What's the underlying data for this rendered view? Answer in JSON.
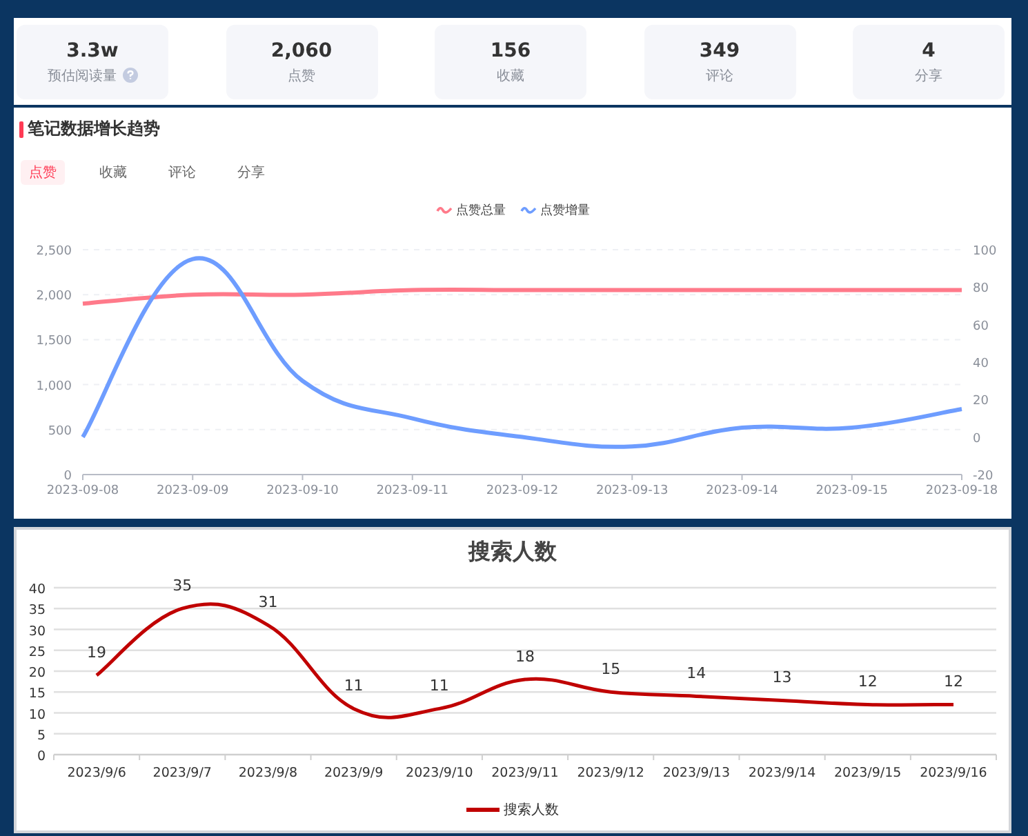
{
  "stats": [
    {
      "value": "3.3w",
      "label": "预估阅读量",
      "help": true
    },
    {
      "value": "2,060",
      "label": "点赞",
      "help": false
    },
    {
      "value": "156",
      "label": "收藏",
      "help": false
    },
    {
      "value": "349",
      "label": "评论",
      "help": false
    },
    {
      "value": "4",
      "label": "分享",
      "help": false
    }
  ],
  "trend": {
    "title": "笔记数据增长趋势",
    "tabs": [
      {
        "label": "点赞",
        "selected": true
      },
      {
        "label": "收藏",
        "selected": false
      },
      {
        "label": "评论",
        "selected": false
      },
      {
        "label": "分享",
        "selected": false
      }
    ],
    "chart_data": {
      "type": "line",
      "categories": [
        "2023-09-08",
        "2023-09-09",
        "2023-09-10",
        "2023-09-11",
        "2023-09-12",
        "2023-09-13",
        "2023-09-14",
        "2023-09-15",
        "2023-09-18"
      ],
      "series": [
        {
          "name": "点赞总量",
          "color": "#ff7a8a",
          "values": [
            1900,
            2000,
            2000,
            2050,
            2050,
            2050,
            2050,
            2050,
            2050
          ]
        },
        {
          "name": "点赞增量",
          "color": "#6e9dff",
          "axis": "y2",
          "values": [
            0,
            95,
            30,
            10,
            0,
            -5,
            5,
            5,
            15
          ]
        }
      ],
      "ylim": [
        0,
        2500
      ],
      "yticks": [
        0,
        500,
        {
          "value": 1000,
          "label": "1,000"
        },
        {
          "value": 1500,
          "label": "1,500"
        },
        {
          "value": 2000,
          "label": "2,000"
        },
        {
          "value": 2500,
          "label": "2,500"
        }
      ],
      "y2lim": [
        -20,
        100
      ],
      "y2ticks": [
        -20,
        0,
        20,
        40,
        60,
        80,
        100
      ],
      "grid": true
    }
  },
  "search": {
    "chart_data": {
      "type": "line",
      "title": "搜索人数",
      "categories": [
        "2023/9/6",
        "2023/9/7",
        "2023/9/8",
        "2023/9/9",
        "2023/9/10",
        "2023/9/11",
        "2023/9/12",
        "2023/9/13",
        "2023/9/14",
        "2023/9/15",
        "2023/9/16"
      ],
      "series": [
        {
          "name": "搜索人数",
          "color": "#c00000",
          "values": [
            19,
            35,
            31,
            11,
            11,
            18,
            15,
            14,
            13,
            12,
            12
          ]
        }
      ],
      "ylim": [
        0,
        40
      ],
      "yticks": [
        0,
        5,
        10,
        15,
        20,
        25,
        30,
        35,
        40
      ],
      "grid": true,
      "data_labels": true
    }
  }
}
